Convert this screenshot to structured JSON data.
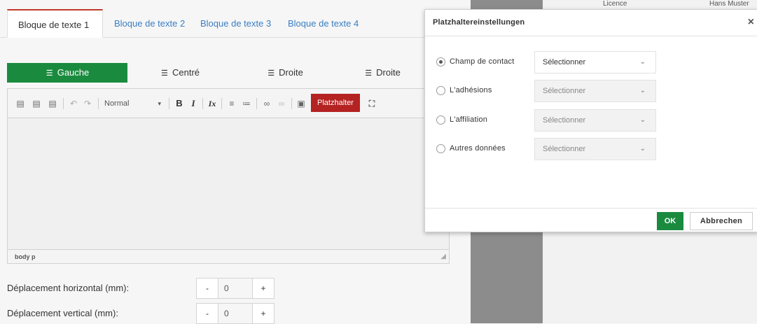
{
  "tabs": [
    {
      "label": "Bloque de texte 1",
      "active": true
    },
    {
      "label": "Bloque de texte 2",
      "active": false
    },
    {
      "label": "Bloque de texte 3",
      "active": false
    },
    {
      "label": "Bloque de texte 4",
      "active": false
    }
  ],
  "alignment": {
    "left": "Gauche",
    "center": "Centré",
    "right": "Droite",
    "justify": "Droite"
  },
  "editor": {
    "format_select": "Normal",
    "bold": "B",
    "italic": "I",
    "clear_format": "Ix",
    "placeholder_button": "Platzhalter",
    "status_path": "body  p"
  },
  "offsets": {
    "horizontal_label": "Déplacement horizontal (mm):",
    "horizontal_value": "0",
    "vertical_label": "Déplacement vertical (mm):",
    "vertical_value": "0",
    "minus": "-",
    "plus": "+"
  },
  "background_headers": {
    "col1": "Licence",
    "col2": "Hans Muster"
  },
  "modal": {
    "title": "Platzhaltereinstellungen",
    "close": "×",
    "options": [
      {
        "label": "Champ de contact",
        "checked": true,
        "select": "Sélectionner",
        "disabled": false
      },
      {
        "label": "L'adhésions",
        "checked": false,
        "select": "Sélectionner",
        "disabled": true
      },
      {
        "label": "L'affiliation",
        "checked": false,
        "select": "Sélectionner",
        "disabled": true
      },
      {
        "label": "Autres données",
        "checked": false,
        "select": "Sélectionner",
        "disabled": true
      }
    ],
    "ok": "OK",
    "cancel": "Abbrechen"
  },
  "colors": {
    "accent_green": "#1a8b3e",
    "placeholder_red": "#b52222",
    "tab_active_border": "#c0392b",
    "link_blue": "#3a7fc1"
  }
}
